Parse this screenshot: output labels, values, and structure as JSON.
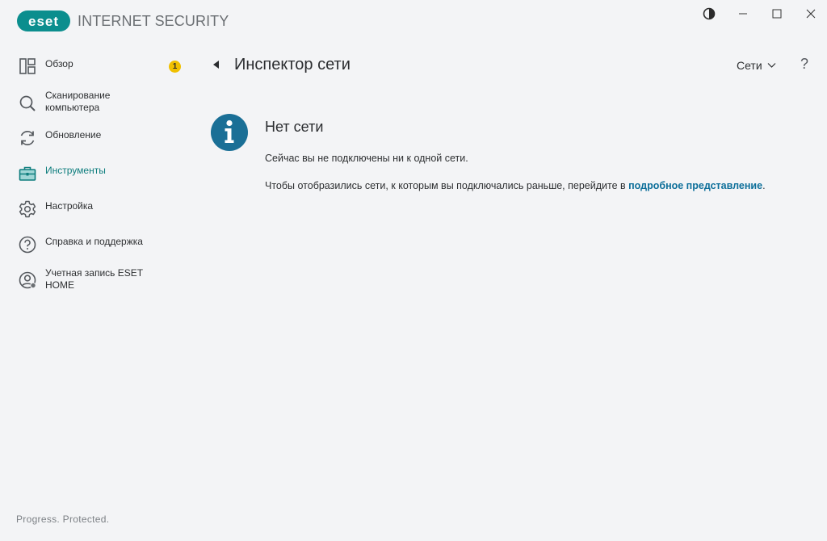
{
  "app": {
    "logo_text": "eset",
    "product_name": "INTERNET SECURITY",
    "brand_color": "#0b8e8e"
  },
  "window_controls": {
    "theme_icon": "contrast-icon",
    "minimize_icon": "minimize-icon",
    "maximize_icon": "maximize-icon",
    "close_icon": "close-icon"
  },
  "sidebar": {
    "items": [
      {
        "label": "Обзор",
        "icon": "overview-icon",
        "badge": "1",
        "active": false
      },
      {
        "label": "Сканирование компьютера",
        "icon": "search-icon",
        "active": false
      },
      {
        "label": "Обновление",
        "icon": "refresh-icon",
        "active": false
      },
      {
        "label": "Инструменты",
        "icon": "toolbox-icon",
        "active": true
      },
      {
        "label": "Настройка",
        "icon": "gear-icon",
        "active": false
      },
      {
        "label": "Справка и поддержка",
        "icon": "help-circle-icon",
        "active": false
      },
      {
        "label": "Учетная запись ESET HOME",
        "icon": "account-icon",
        "active": false
      }
    ],
    "footer": "Progress. Protected."
  },
  "main": {
    "title": "Инспектор сети",
    "dropdown_label": "Сети",
    "help_label": "?",
    "message": {
      "title": "Нет сети",
      "line1": "Сейчас вы не подключены ни к одной сети.",
      "line2_prefix": "Чтобы отобразились сети, к которым вы подключались раньше, перейдите в ",
      "line2_link": "подробное представление",
      "line2_suffix": "."
    }
  },
  "colors": {
    "active_nav": "#0d7d7d",
    "badge": "#f0c000",
    "info_icon": "#1a6f96",
    "link": "#0d6f9a"
  }
}
